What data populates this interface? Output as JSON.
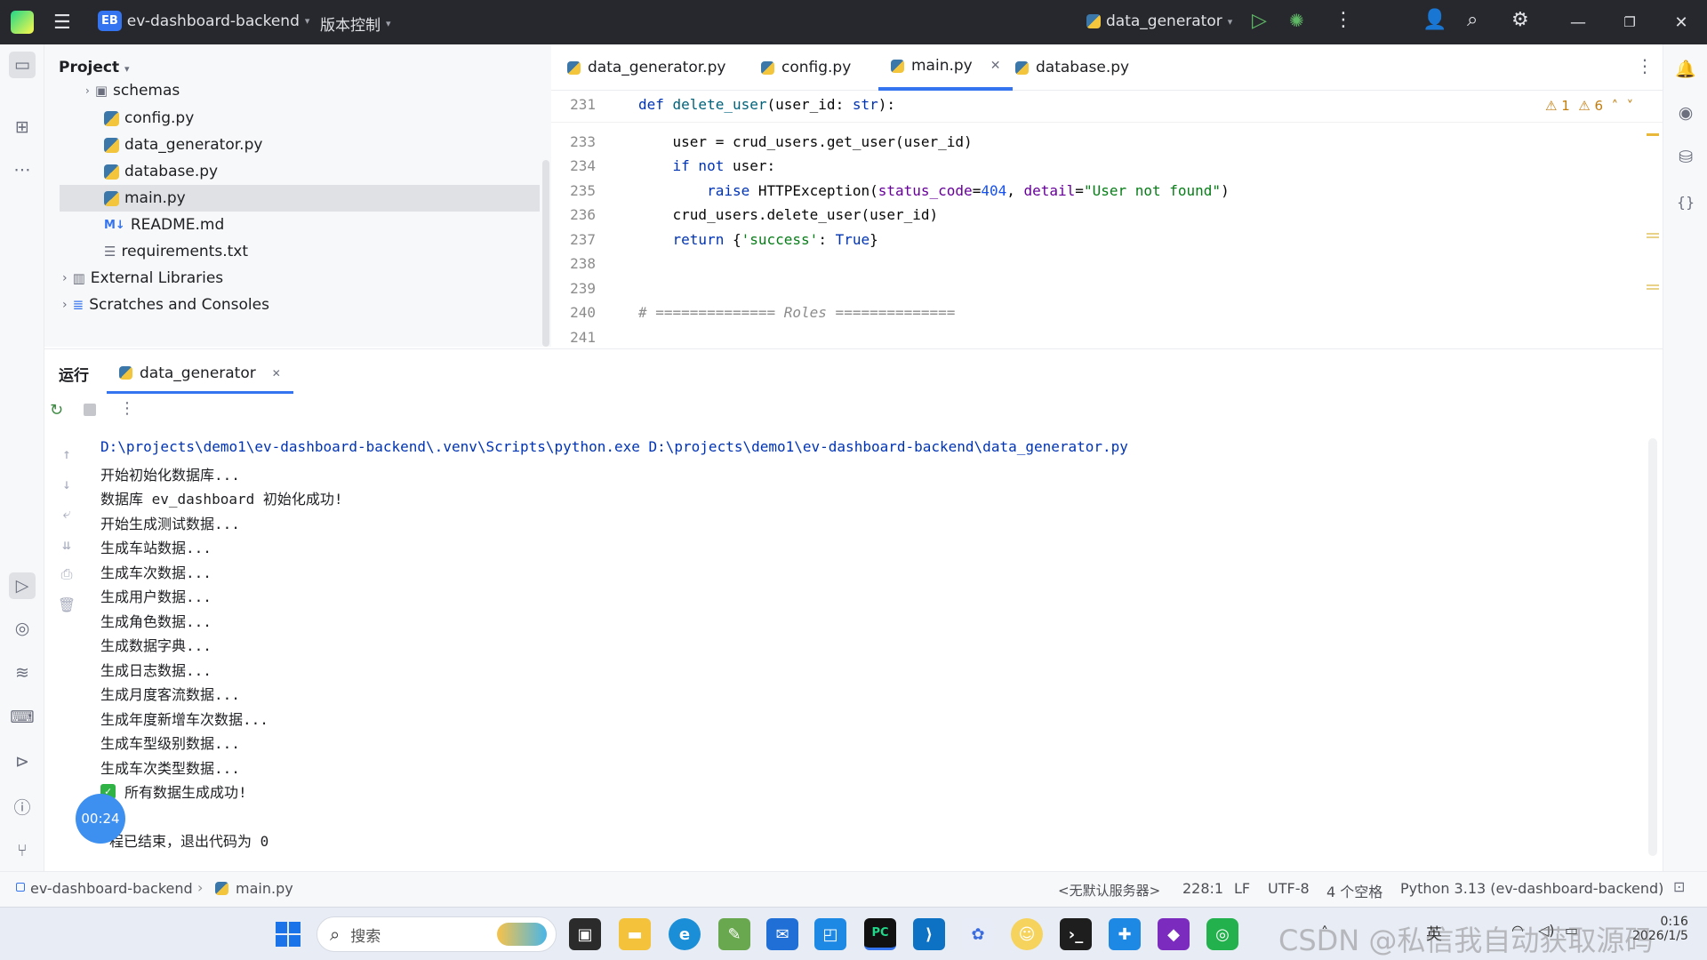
{
  "titlebar": {
    "project_badge": "EB",
    "project_name": "ev-dashboard-backend",
    "vcs_menu": "版本控制",
    "run_config": "data_generator"
  },
  "project_panel": {
    "header": "Project",
    "items": [
      {
        "label": "schemas",
        "type": "folder"
      },
      {
        "label": "config.py",
        "type": "py"
      },
      {
        "label": "data_generator.py",
        "type": "py"
      },
      {
        "label": "database.py",
        "type": "py"
      },
      {
        "label": "main.py",
        "type": "py",
        "selected": true
      },
      {
        "label": "README.md",
        "type": "md"
      },
      {
        "label": "requirements.txt",
        "type": "txt"
      },
      {
        "label": "External Libraries",
        "type": "lib"
      },
      {
        "label": "Scratches and Consoles",
        "type": "scratch"
      }
    ]
  },
  "editor": {
    "tabs": [
      {
        "label": "data_generator.py"
      },
      {
        "label": "config.py"
      },
      {
        "label": "main.py",
        "active": true
      },
      {
        "label": "database.py"
      }
    ],
    "warnings": "1",
    "weak_warnings": "6",
    "sticky_line": "231",
    "sticky_code": "def delete_user(user_id: str):",
    "lines": [
      {
        "n": "233",
        "code": "    user = crud_users.get_user(user_id)"
      },
      {
        "n": "234",
        "code": "    if not user:"
      },
      {
        "n": "235",
        "code": "        raise HTTPException(status_code=404, detail=\"User not found\")"
      },
      {
        "n": "236",
        "code": "    crud_users.delete_user(user_id)"
      },
      {
        "n": "237",
        "code": "    return {'success': True}"
      },
      {
        "n": "238",
        "code": ""
      },
      {
        "n": "239",
        "code": ""
      },
      {
        "n": "240",
        "code": "# ============== Roles =============="
      },
      {
        "n": "241",
        "code": ""
      }
    ]
  },
  "run_panel": {
    "title": "运行",
    "tab": "data_generator",
    "output": [
      "D:\\projects\\demo1\\ev-dashboard-backend\\.venv\\Scripts\\python.exe D:\\projects\\demo1\\ev-dashboard-backend\\data_generator.py",
      "开始初始化数据库...",
      "数据库 ev_dashboard 初始化成功!",
      "开始生成测试数据...",
      "生成车站数据...",
      "生成车次数据...",
      "生成用户数据...",
      "生成角色数据...",
      "生成数据字典...",
      "生成日志数据...",
      "生成月度客流数据...",
      "生成年度新增车次数据...",
      "生成车型级别数据...",
      "生成车次类型数据..."
    ],
    "success_line": "所有数据生成成功!",
    "exit_line": "程已结束，退出代码为 0",
    "timer": "00:24"
  },
  "statusbar": {
    "project": "ev-dashboard-backend",
    "file": "main.py",
    "server": "<无默认服务器>",
    "position": "228:1",
    "line_sep": "LF",
    "encoding": "UTF-8",
    "indent": "4 个空格",
    "interpreter": "Python 3.13 (ev-dashboard-backend)"
  },
  "taskbar": {
    "search_placeholder": "搜索",
    "ime": "英",
    "time": "0:16",
    "date": "2026/1/5",
    "watermark": "CSDN @私信我自动获取源码"
  },
  "colors": {
    "titlebar_bg": "#27282e",
    "accent": "#3574f0",
    "keyword": "#0033b3",
    "string": "#067d17",
    "number": "#1750eb",
    "success": "#2fb344"
  }
}
